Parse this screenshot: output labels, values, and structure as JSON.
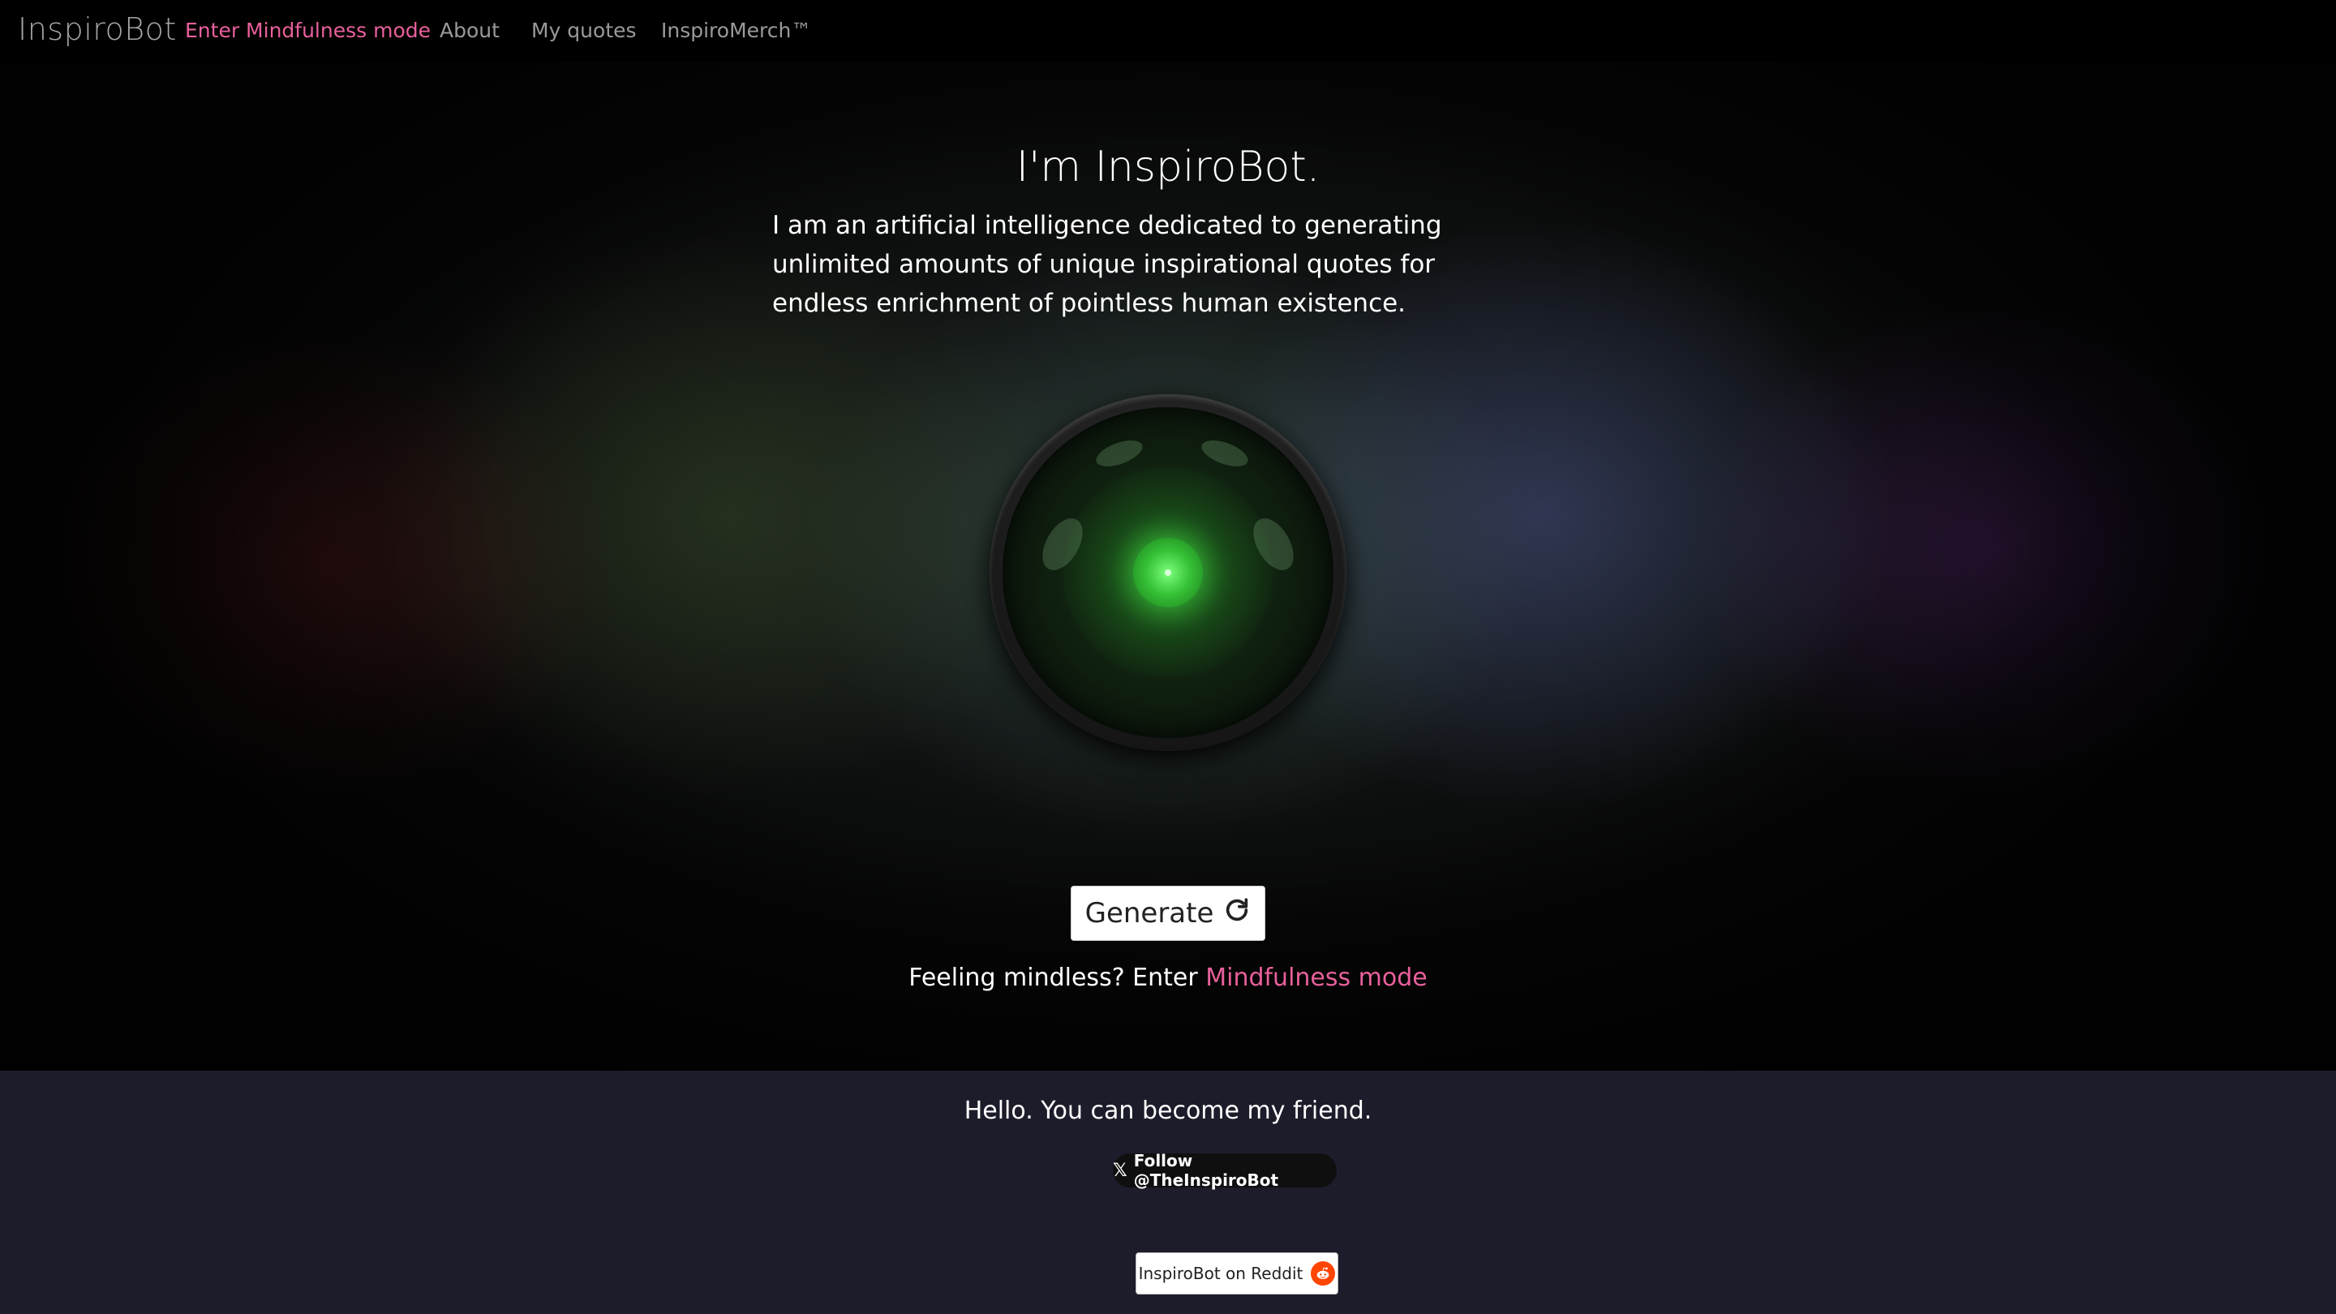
{
  "nav": {
    "brand": "InspiroBot",
    "items": [
      {
        "label": "Enter Mindfulness mode",
        "accent": "#e8609c"
      },
      {
        "label": "About"
      },
      {
        "label": "My quotes"
      },
      {
        "label": "InspiroMerch™"
      }
    ]
  },
  "hero": {
    "title": "I'm InspiroBot.",
    "description": "I am an artificial intelligence dedicated to generating unlimited amounts of unique inspirational quotes for endless enrichment of pointless human existence.",
    "generate_label": "Generate",
    "generate_icon": "refresh-icon",
    "mindful_prefix": "Feeling mindless? Enter ",
    "mindful_link": "Mindfulness mode"
  },
  "footer": {
    "friend_text": "Hello. You can become my friend.",
    "x_follow_label": "Follow @TheInspiroBot",
    "x_icon": "x-logo-icon",
    "reddit_label": "InspiroBot on Reddit",
    "reddit_icon": "reddit-icon"
  },
  "colors": {
    "accent_pink": "#e8609c",
    "footer_bg": "#1c1c2b",
    "eye_green": "#36c236"
  }
}
